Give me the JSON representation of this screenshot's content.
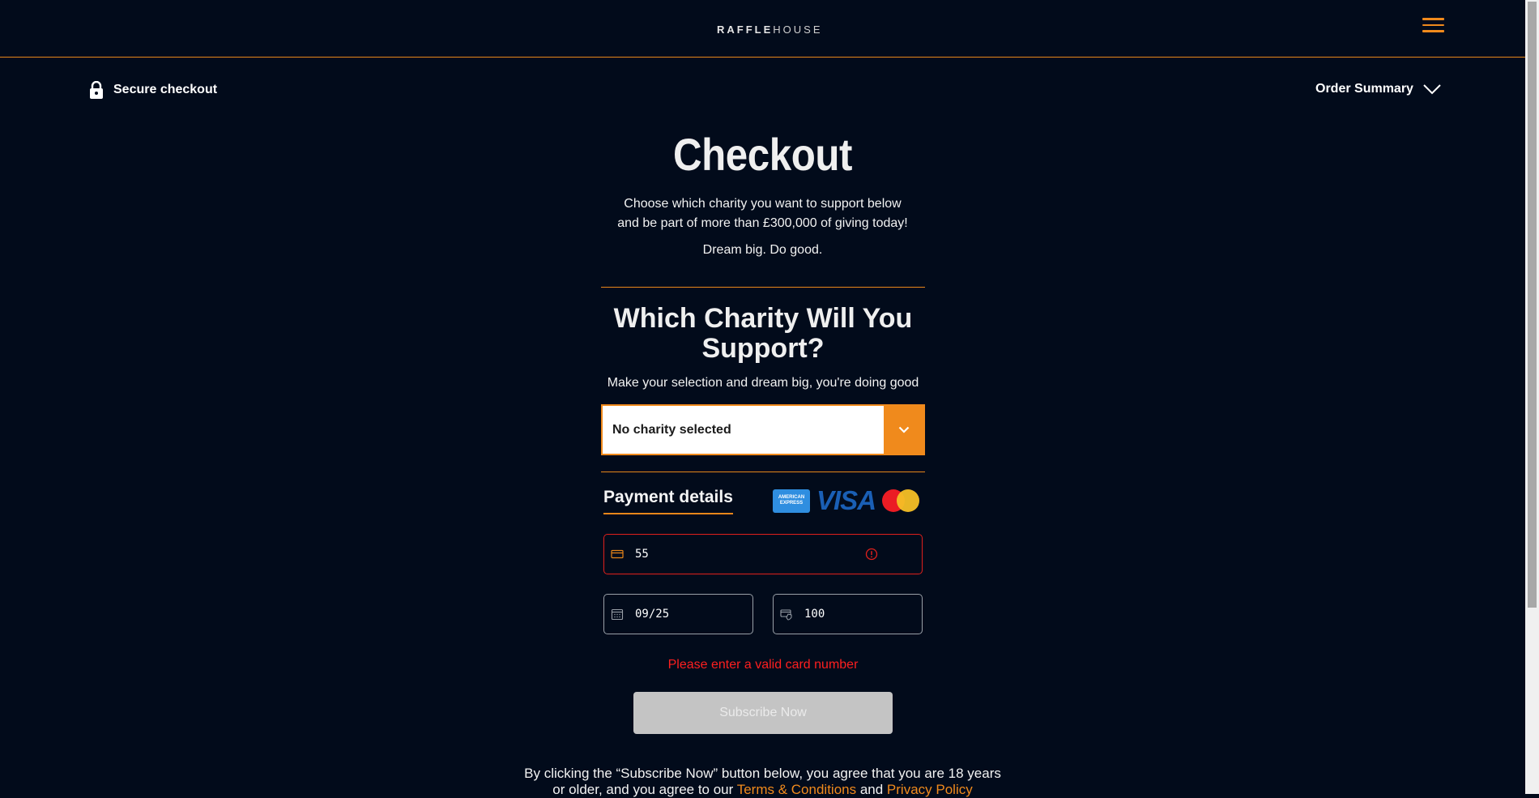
{
  "header": {
    "logo_bold": "RAFFLE",
    "logo_light": "HOUSE"
  },
  "secure_checkout": {
    "label": "Secure checkout",
    "icon": "lock-icon"
  },
  "order_summary": {
    "label": "Order Summary",
    "icon": "chevron-down-icon"
  },
  "page": {
    "title": "Checkout",
    "intro_line1": "Choose which charity you want to support below",
    "intro_line2": "and be part of more than £300,000 of giving today!",
    "tagline": "Dream big. Do good."
  },
  "charity": {
    "heading_line1": "Which Charity Will You",
    "heading_line2": "Support?",
    "subheading": "Make your selection and dream big, you're doing good",
    "selected_value": "No charity selected"
  },
  "payment": {
    "title": "Payment details",
    "card_logos": [
      "American Express",
      "VISA",
      "Mastercard"
    ],
    "amex_label": "AMERICAN EXPRESS",
    "visa_label": "VISA",
    "card_number_value": "55",
    "expiry_value": "09/25",
    "cvc_value": "100",
    "error_message": "Please enter a valid card number"
  },
  "subscribe": {
    "label": "Subscribe Now"
  },
  "legal": {
    "text_before": "By clicking the “Subscribe Now” button below, you agree that you are 18 years or older, and you agree to our ",
    "terms_link": "Terms & Conditions",
    "and": " and ",
    "privacy_link": "Privacy Policy"
  },
  "colors": {
    "background": "#020b1b",
    "accent": "#f08a1c",
    "error": "#ff1f1f",
    "button_disabled": "#c4c4c4"
  }
}
